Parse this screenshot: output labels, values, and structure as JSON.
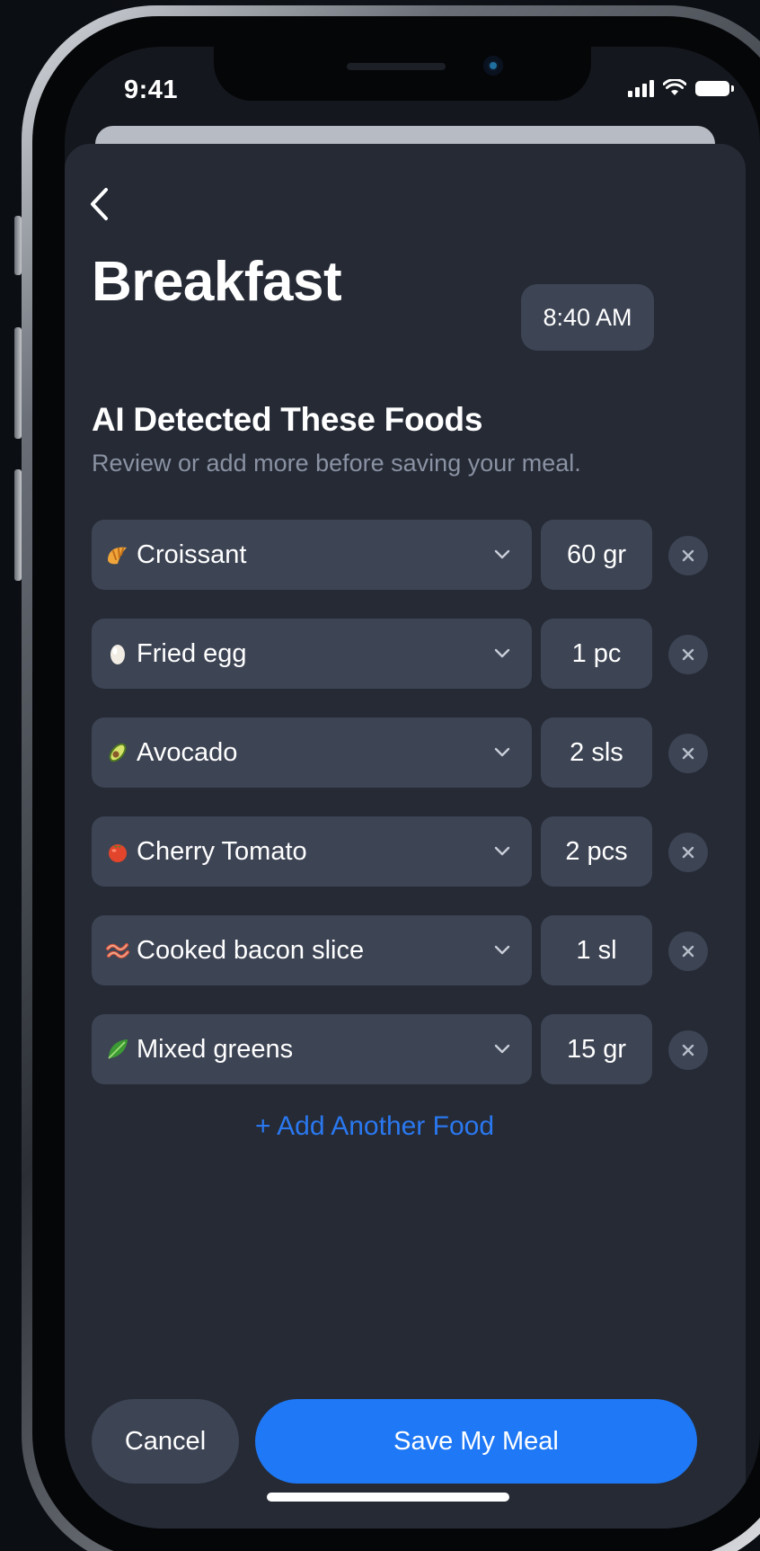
{
  "status_bar": {
    "time": "9:41"
  },
  "header": {
    "title": "Breakfast",
    "meal_time": "8:40 AM"
  },
  "section": {
    "title": "AI Detected These Foods",
    "subtitle": "Review or add more before saving your meal."
  },
  "foods": [
    {
      "icon": "croissant-icon",
      "name": "Croissant",
      "quantity": "60 gr"
    },
    {
      "icon": "egg-icon",
      "name": "Fried egg",
      "quantity": "1 pc"
    },
    {
      "icon": "avocado-icon",
      "name": "Avocado",
      "quantity": "2 sls"
    },
    {
      "icon": "tomato-icon",
      "name": "Cherry Tomato",
      "quantity": "2 pcs"
    },
    {
      "icon": "bacon-icon",
      "name": "Cooked bacon slice",
      "quantity": "1 sl"
    },
    {
      "icon": "greens-icon",
      "name": "Mixed greens",
      "quantity": "15 gr"
    }
  ],
  "actions": {
    "add_food": "+ Add Another Food",
    "cancel": "Cancel",
    "save": "Save My Meal"
  },
  "colors": {
    "background": "#14171d",
    "sheet": "#252a35",
    "field": "#3d4454",
    "accent": "#1f78f5",
    "link": "#2a78f0",
    "muted_text": "#8a92a3"
  }
}
